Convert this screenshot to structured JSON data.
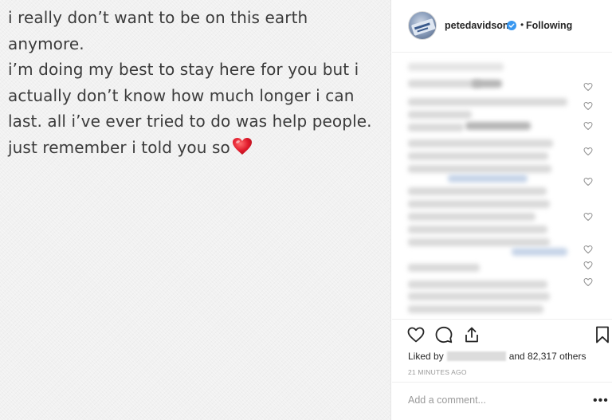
{
  "post": {
    "text": "i really don’t want to be on this earth anymore.\ni’m doing my best to stay here for you but i\nactually don’t know how much longer i can\nlast. all i’ve ever tried to do was help people.\njust remember i told you so",
    "emoji": "heart-emoji"
  },
  "header": {
    "username": "petedavidson",
    "separator": "•",
    "follow_status": "Following",
    "verified": true
  },
  "likes": {
    "prefix": "Liked by",
    "suffix": "and 82,317 others"
  },
  "timestamp": "21 MINUTES AGO",
  "comment": {
    "placeholder": "Add a comment...",
    "more_label": "•••"
  },
  "colors": {
    "verified_blue": "#3897f0",
    "emoji_red": "#e01a2b",
    "muted_text": "#999999"
  }
}
